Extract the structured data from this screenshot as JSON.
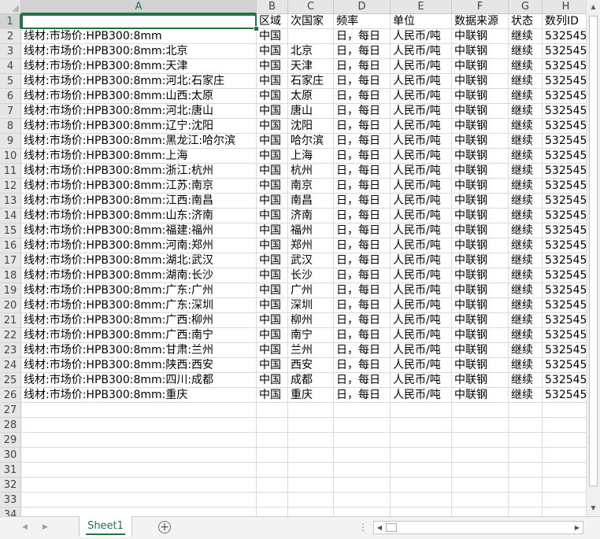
{
  "columns": [
    {
      "letter": "A",
      "header": ""
    },
    {
      "letter": "B",
      "header": "区域"
    },
    {
      "letter": "C",
      "header": "次国家"
    },
    {
      "letter": "D",
      "header": "频率"
    },
    {
      "letter": "E",
      "header": "单位"
    },
    {
      "letter": "F",
      "header": "数据来源"
    },
    {
      "letter": "G",
      "header": "状态"
    },
    {
      "letter": "H",
      "header": "数列ID"
    }
  ],
  "rows": [
    [
      "线材:市场价:HPB300:8mm",
      "中国",
      "",
      "日，每日",
      "人民币/吨",
      "中联钢",
      "继续",
      "532545"
    ],
    [
      "线材:市场价:HPB300:8mm:北京",
      "中国",
      "北京",
      "日，每日",
      "人民币/吨",
      "中联钢",
      "继续",
      "532545"
    ],
    [
      "线材:市场价:HPB300:8mm:天津",
      "中国",
      "天津",
      "日，每日",
      "人民币/吨",
      "中联钢",
      "继续",
      "532545"
    ],
    [
      "线材:市场价:HPB300:8mm:河北:石家庄",
      "中国",
      "石家庄",
      "日，每日",
      "人民币/吨",
      "中联钢",
      "继续",
      "532545"
    ],
    [
      "线材:市场价:HPB300:8mm:山西:太原",
      "中国",
      "太原",
      "日，每日",
      "人民币/吨",
      "中联钢",
      "继续",
      "532545"
    ],
    [
      "线材:市场价:HPB300:8mm:河北:唐山",
      "中国",
      "唐山",
      "日，每日",
      "人民币/吨",
      "中联钢",
      "继续",
      "532545"
    ],
    [
      "线材:市场价:HPB300:8mm:辽宁:沈阳",
      "中国",
      "沈阳",
      "日，每日",
      "人民币/吨",
      "中联钢",
      "继续",
      "532545"
    ],
    [
      "线材:市场价:HPB300:8mm:黑龙江:哈尔滨",
      "中国",
      "哈尔滨",
      "日，每日",
      "人民币/吨",
      "中联钢",
      "继续",
      "532545"
    ],
    [
      "线材:市场价:HPB300:8mm:上海",
      "中国",
      "上海",
      "日，每日",
      "人民币/吨",
      "中联钢",
      "继续",
      "532545"
    ],
    [
      "线材:市场价:HPB300:8mm:浙江:杭州",
      "中国",
      "杭州",
      "日，每日",
      "人民币/吨",
      "中联钢",
      "继续",
      "532545"
    ],
    [
      "线材:市场价:HPB300:8mm:江苏:南京",
      "中国",
      "南京",
      "日，每日",
      "人民币/吨",
      "中联钢",
      "继续",
      "532545"
    ],
    [
      "线材:市场价:HPB300:8mm:江西:南昌",
      "中国",
      "南昌",
      "日，每日",
      "人民币/吨",
      "中联钢",
      "继续",
      "532545"
    ],
    [
      "线材:市场价:HPB300:8mm:山东:济南",
      "中国",
      "济南",
      "日，每日",
      "人民币/吨",
      "中联钢",
      "继续",
      "532545"
    ],
    [
      "线材:市场价:HPB300:8mm:福建:福州",
      "中国",
      "福州",
      "日，每日",
      "人民币/吨",
      "中联钢",
      "继续",
      "532545"
    ],
    [
      "线材:市场价:HPB300:8mm:河南:郑州",
      "中国",
      "郑州",
      "日，每日",
      "人民币/吨",
      "中联钢",
      "继续",
      "532545"
    ],
    [
      "线材:市场价:HPB300:8mm:湖北:武汉",
      "中国",
      "武汉",
      "日，每日",
      "人民币/吨",
      "中联钢",
      "继续",
      "532545"
    ],
    [
      "线材:市场价:HPB300:8mm:湖南:长沙",
      "中国",
      "长沙",
      "日，每日",
      "人民币/吨",
      "中联钢",
      "继续",
      "532545"
    ],
    [
      "线材:市场价:HPB300:8mm:广东:广州",
      "中国",
      "广州",
      "日，每日",
      "人民币/吨",
      "中联钢",
      "继续",
      "532545"
    ],
    [
      "线材:市场价:HPB300:8mm:广东:深圳",
      "中国",
      "深圳",
      "日，每日",
      "人民币/吨",
      "中联钢",
      "继续",
      "532545"
    ],
    [
      "线材:市场价:HPB300:8mm:广西:柳州",
      "中国",
      "柳州",
      "日，每日",
      "人民币/吨",
      "中联钢",
      "继续",
      "532545"
    ],
    [
      "线材:市场价:HPB300:8mm:广西:南宁",
      "中国",
      "南宁",
      "日，每日",
      "人民币/吨",
      "中联钢",
      "继续",
      "532545"
    ],
    [
      "线材:市场价:HPB300:8mm:甘肃:兰州",
      "中国",
      "兰州",
      "日，每日",
      "人民币/吨",
      "中联钢",
      "继续",
      "532545"
    ],
    [
      "线材:市场价:HPB300:8mm:陕西:西安",
      "中国",
      "西安",
      "日，每日",
      "人民币/吨",
      "中联钢",
      "继续",
      "532545"
    ],
    [
      "线材:市场价:HPB300:8mm:四川:成都",
      "中国",
      "成都",
      "日，每日",
      "人民币/吨",
      "中联钢",
      "继续",
      "532545"
    ],
    [
      "线材:市场价:HPB300:8mm:重庆",
      "中国",
      "重庆",
      "日，每日",
      "人民币/吨",
      "中联钢",
      "继续",
      "532545"
    ]
  ],
  "visible_row_count": 34,
  "active_cell": "A1",
  "sheet_tab": "Sheet1",
  "add_sheet_symbol": "+",
  "colors": {
    "accent": "#217346",
    "header_bg": "#e6e6e6",
    "gridline": "#dadada"
  }
}
